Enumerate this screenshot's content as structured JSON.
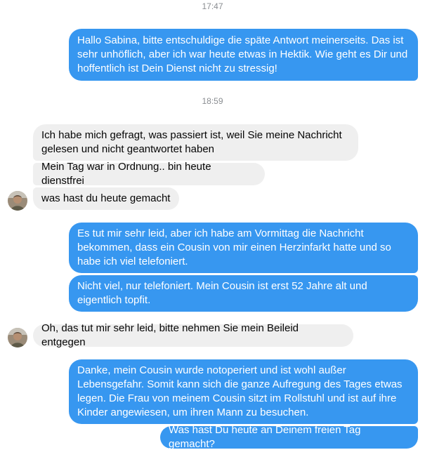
{
  "timestamps": [
    "17:47",
    "18:59"
  ],
  "messages": {
    "m1": "Hallo Sabina, bitte entschuldige die späte Antwort meinerseits. Das ist sehr unhöflich, aber ich war heute etwas in Hektik. Wie geht es Dir und hoffentlich ist Dein Dienst nicht zu stressig!",
    "m2": "Ich habe mich gefragt, was passiert ist, weil Sie meine Nachricht gelesen und nicht geantwortet haben",
    "m3": "Mein Tag war in Ordnung.. bin heute dienstfrei",
    "m4": "was hast du heute gemacht",
    "m5": "Es tut mir sehr leid, aber ich habe am Vormittag die Nachricht bekommen, dass ein Cousin von mir einen Herzinfarkt hatte und so habe ich viel telefoniert.",
    "m6": "Nicht viel, nur telefoniert. Mein Cousin ist erst 52 Jahre alt und eigentlich topfit.",
    "m7": "Oh, das tut mir sehr leid, bitte nehmen Sie mein Beileid entgegen",
    "m8": "Danke, mein Cousin wurde notoperiert und ist wohl außer Lebensgefahr. Somit kann sich die ganze Aufregung des Tages etwas legen. Die Frau von meinem Cousin sitzt im Rollstuhl und ist auf ihre Kinder angewiesen, um ihren Mann zu besuchen.",
    "m9": "Was hast Du heute an Deinem freien Tag gemacht?"
  },
  "colors": {
    "outgoing": "#3797f0",
    "incoming": "#efefef"
  }
}
